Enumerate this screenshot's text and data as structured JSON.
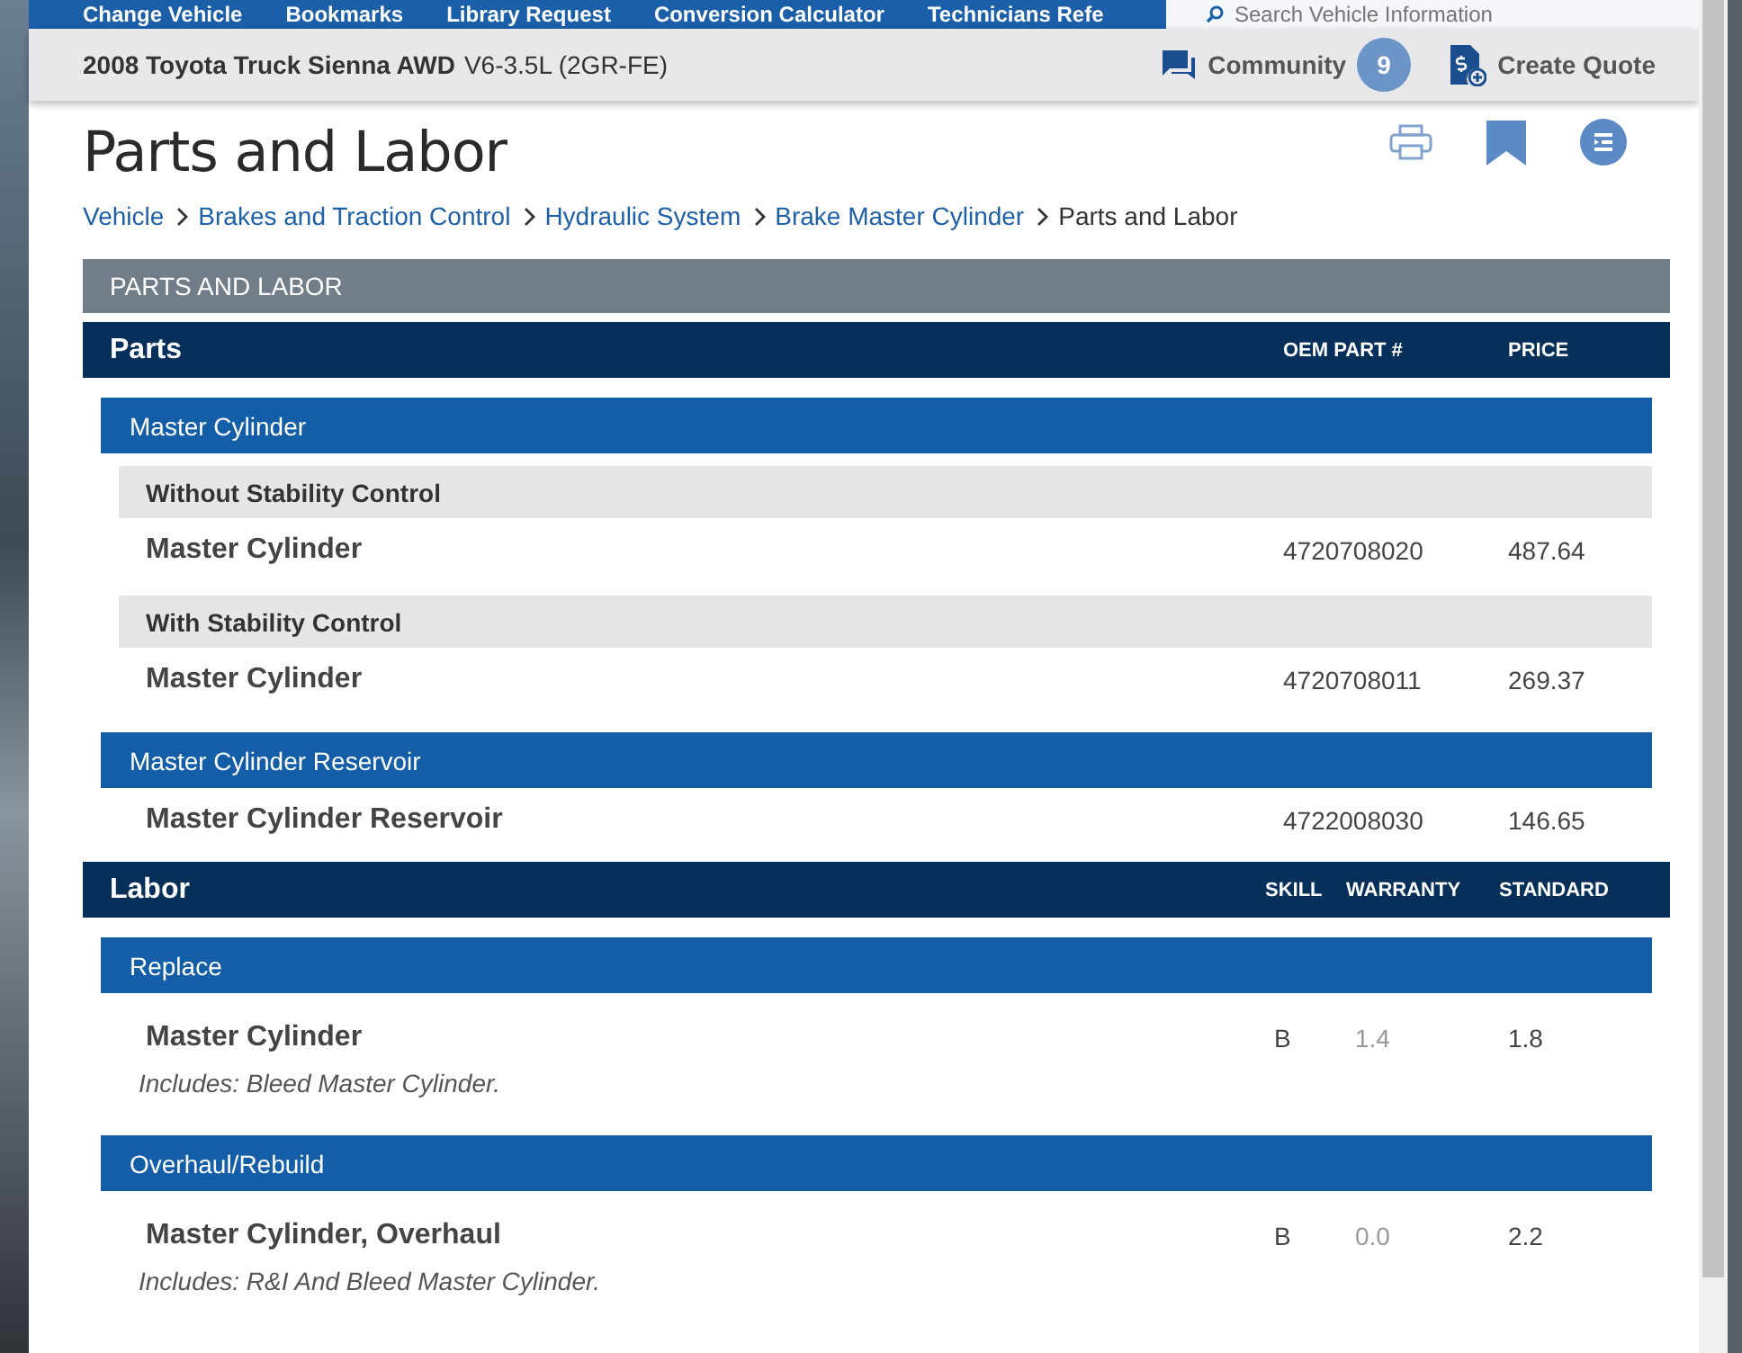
{
  "nav": {
    "items": [
      "Change Vehicle",
      "Bookmarks",
      "Library Request",
      "Conversion Calculator",
      "Technicians Refe"
    ],
    "search": {
      "placeholder": "Search Vehicle Information"
    }
  },
  "vehicle": {
    "name": "2008 Toyota Truck Sienna AWD",
    "engine": "V6-3.5L (2GR-FE)"
  },
  "community": {
    "label": "Community",
    "count": "9"
  },
  "create_quote": {
    "label": "Create Quote"
  },
  "title": "Parts and Labor",
  "breadcrumb": [
    "Vehicle",
    "Brakes and Traction Control",
    "Hydraulic System",
    "Brake Master Cylinder",
    "Parts and Labor"
  ],
  "section_title": "PARTS AND LABOR",
  "parts": {
    "heading": "Parts",
    "columns": [
      "OEM PART #",
      "PRICE"
    ],
    "groups": [
      {
        "name": "Master Cylinder",
        "rows": [
          {
            "kind": "subheading",
            "name": "Without Stability Control"
          },
          {
            "kind": "part",
            "name": "Master Cylinder",
            "part_number": "4720708020",
            "price": "487.64"
          },
          {
            "kind": "subheading",
            "name": "With Stability Control"
          },
          {
            "kind": "part",
            "name": "Master Cylinder",
            "part_number": "4720708011",
            "price": "269.37"
          }
        ]
      },
      {
        "name": "Master Cylinder Reservoir",
        "rows": [
          {
            "kind": "part",
            "name": "Master Cylinder Reservoir",
            "part_number": "4722008030",
            "price": "146.65"
          }
        ]
      }
    ]
  },
  "labor": {
    "heading": "Labor",
    "columns": [
      "SKILL",
      "WARRANTY",
      "STANDARD"
    ],
    "groups": [
      {
        "name": "Replace",
        "items": [
          {
            "name": "Master Cylinder",
            "skill": "B",
            "warranty": "1.4",
            "standard": "1.8",
            "note": "Includes: Bleed Master Cylinder."
          }
        ]
      },
      {
        "name": "Overhaul/Rebuild",
        "items": [
          {
            "name": "Master Cylinder, Overhaul",
            "skill": "B",
            "warranty": "0.0",
            "standard": "2.2",
            "note": "Includes: R&I And Bleed Master Cylinder."
          }
        ]
      }
    ]
  }
}
